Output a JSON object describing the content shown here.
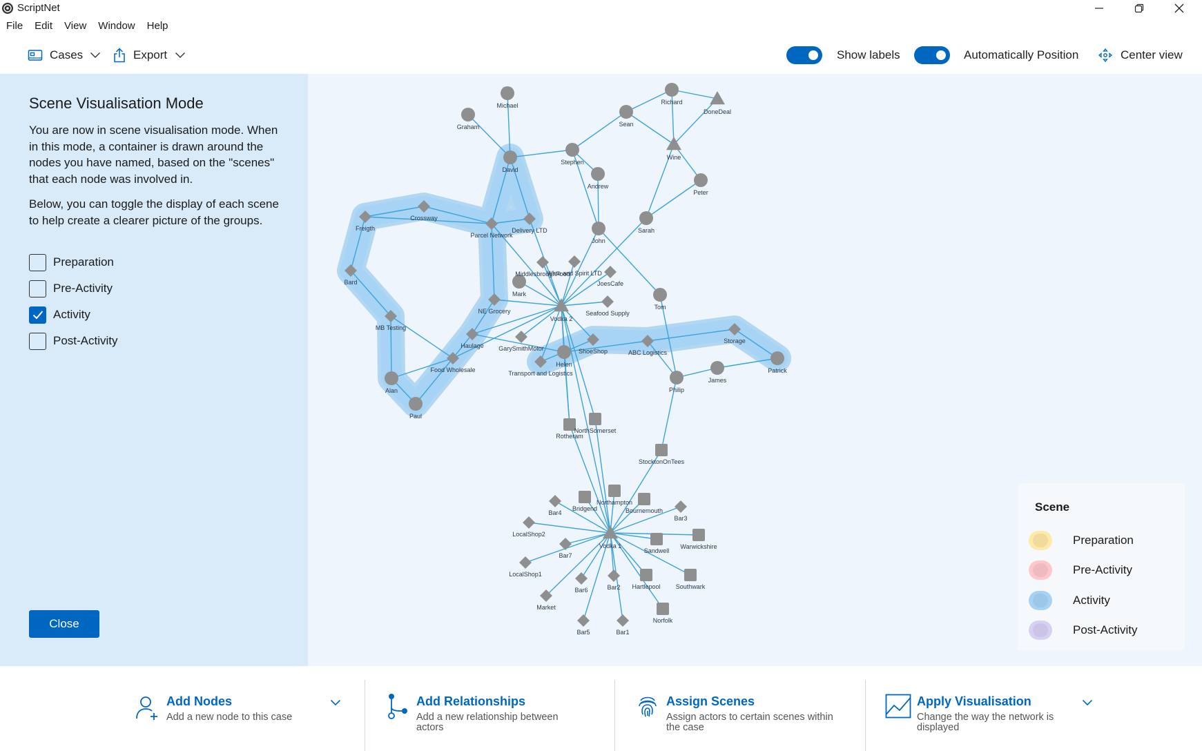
{
  "app": {
    "title": "ScriptNet"
  },
  "menu": [
    "File",
    "Edit",
    "View",
    "Window",
    "Help"
  ],
  "toolbar": {
    "cases_label": "Cases",
    "export_label": "Export",
    "show_labels": "Show labels",
    "show_labels_on": true,
    "auto_position": "Automatically Position",
    "auto_position_on": true,
    "center_view": "Center view"
  },
  "side_panel": {
    "title": "Scene Visualisation Mode",
    "para1": "You are now in scene visualisation mode. When in this mode, a container is drawn around the nodes you have named, based on the \"scenes\" that each node was involved in.",
    "para2": "Below, you can toggle the display of each scene to help create a clearer picture of the groups.",
    "scenes": [
      {
        "label": "Preparation",
        "checked": false
      },
      {
        "label": "Pre-Activity",
        "checked": false
      },
      {
        "label": "Activity",
        "checked": true
      },
      {
        "label": "Post-Activity",
        "checked": false
      }
    ],
    "close_label": "Close"
  },
  "legend": {
    "title": "Scene",
    "items": [
      {
        "label": "Preparation",
        "color": "#ffe9a6"
      },
      {
        "label": "Pre-Activity",
        "color": "#ffc7cc"
      },
      {
        "label": "Activity",
        "color": "#a6d3f5"
      },
      {
        "label": "Post-Activity",
        "color": "#d7d0f5"
      }
    ]
  },
  "graph": {
    "node_color": "#8f8f8f",
    "edge_color": "#3ea3d8",
    "hull_color": "#9dcdf0",
    "nodes": [
      {
        "id": "Michael",
        "label": "Michael",
        "shape": "circle"
      },
      {
        "id": "Graham",
        "label": "Graham",
        "shape": "circle"
      },
      {
        "id": "David",
        "label": "David",
        "shape": "circle"
      },
      {
        "id": "Stephen",
        "label": "Stephen",
        "shape": "circle"
      },
      {
        "id": "Andrew",
        "label": "Andrew",
        "shape": "circle"
      },
      {
        "id": "Sean",
        "label": "Sean",
        "shape": "circle"
      },
      {
        "id": "Richard",
        "label": "Richard",
        "shape": "circle"
      },
      {
        "id": "DoneDeal",
        "label": "DoneDeal",
        "shape": "triangle"
      },
      {
        "id": "Wine",
        "label": "Wine",
        "shape": "triangle"
      },
      {
        "id": "Peter",
        "label": "Peter",
        "shape": "circle"
      },
      {
        "id": "Sarah",
        "label": "Sarah",
        "shape": "circle"
      },
      {
        "id": "John",
        "label": "John",
        "shape": "circle"
      },
      {
        "id": "Tom",
        "label": "Tom",
        "shape": "circle"
      },
      {
        "id": "Mark",
        "label": "Mark",
        "shape": "circle"
      },
      {
        "id": "Helen",
        "label": "Helen",
        "shape": "circle"
      },
      {
        "id": "Philip",
        "label": "Philip",
        "shape": "circle"
      },
      {
        "id": "James",
        "label": "James",
        "shape": "circle"
      },
      {
        "id": "Patrick",
        "label": "Patrick",
        "shape": "circle"
      },
      {
        "id": "Alan",
        "label": "Alan",
        "shape": "circle"
      },
      {
        "id": "Paul",
        "label": "Paul",
        "shape": "circle"
      },
      {
        "id": "Freight",
        "label": "Freigth",
        "shape": "diamond"
      },
      {
        "id": "Crossway",
        "label": "Crossway",
        "shape": "diamond"
      },
      {
        "id": "ParcelNetwork",
        "label": "Parcel Network",
        "shape": "diamond"
      },
      {
        "id": "DeliveryLTD",
        "label": "Delivery LTD",
        "shape": "diamond"
      },
      {
        "id": "Bard",
        "label": "Bard",
        "shape": "diamond"
      },
      {
        "id": "MBTesting",
        "label": "MB Testing",
        "shape": "diamond"
      },
      {
        "id": "NEGrocery",
        "label": "NE Grocery",
        "shape": "diamond"
      },
      {
        "id": "Haulage",
        "label": "Haulage",
        "shape": "diamond"
      },
      {
        "id": "FoodWholesale",
        "label": "Food Wholesale",
        "shape": "diamond"
      },
      {
        "id": "Middlesbrough",
        "label": "MiddlesbroughFood",
        "shape": "diamond"
      },
      {
        "id": "WineSpirit",
        "label": "Wine and Spirit LTD",
        "shape": "diamond"
      },
      {
        "id": "JoesCafe",
        "label": "JoesCafe",
        "shape": "diamond"
      },
      {
        "id": "SeafoodSupply",
        "label": "Seafood Supply",
        "shape": "diamond"
      },
      {
        "id": "Vodka2",
        "label": "Vodka 2",
        "shape": "triangle"
      },
      {
        "id": "GarySmithMotor",
        "label": "GarySmithMotor",
        "shape": "diamond"
      },
      {
        "id": "ShoeShop",
        "label": "ShoeShop",
        "shape": "diamond"
      },
      {
        "id": "TransportLogistics",
        "label": "Transport and Logistics",
        "shape": "diamond"
      },
      {
        "id": "ABCLogistics",
        "label": "ABC Logistics",
        "shape": "diamond"
      },
      {
        "id": "Storage",
        "label": "Storage",
        "shape": "diamond"
      },
      {
        "id": "Rotheram",
        "label": "Rotheram",
        "shape": "square"
      },
      {
        "id": "NorthSomerset",
        "label": "NorthSomerset",
        "shape": "square"
      },
      {
        "id": "StocktonOnTees",
        "label": "StocktonOnTees",
        "shape": "square"
      },
      {
        "id": "Vodka1",
        "label": "Vodka 1",
        "shape": "triangle"
      },
      {
        "id": "Bar4",
        "label": "Bar4",
        "shape": "diamond"
      },
      {
        "id": "Bridgend",
        "label": "Bridgend",
        "shape": "square"
      },
      {
        "id": "Northampton",
        "label": "Northampton",
        "shape": "square"
      },
      {
        "id": "Bournemouth",
        "label": "Bournemouth",
        "shape": "square"
      },
      {
        "id": "Bar3",
        "label": "Bar3",
        "shape": "diamond"
      },
      {
        "id": "LocalShop2",
        "label": "LocalShop2",
        "shape": "diamond"
      },
      {
        "id": "Bar7",
        "label": "Bar7",
        "shape": "diamond"
      },
      {
        "id": "Sandwell",
        "label": "Sandwell",
        "shape": "square"
      },
      {
        "id": "Warwickshire",
        "label": "Warwickshire",
        "shape": "square"
      },
      {
        "id": "LocalShop1",
        "label": "LocalShop1",
        "shape": "diamond"
      },
      {
        "id": "Bar6",
        "label": "Bar6",
        "shape": "diamond"
      },
      {
        "id": "Bar2",
        "label": "Bar2",
        "shape": "diamond"
      },
      {
        "id": "Hartlepool",
        "label": "Hartlepool",
        "shape": "square"
      },
      {
        "id": "Southwark",
        "label": "Southwark",
        "shape": "square"
      },
      {
        "id": "Market",
        "label": "Market",
        "shape": "diamond"
      },
      {
        "id": "Norfolk",
        "label": "Norfolk",
        "shape": "square"
      },
      {
        "id": "Bar5",
        "label": "Bar5",
        "shape": "diamond"
      },
      {
        "id": "Bar1",
        "label": "Bar1",
        "shape": "diamond"
      }
    ],
    "edges": [
      [
        "Michael",
        "David"
      ],
      [
        "Graham",
        "David"
      ],
      [
        "David",
        "Stephen"
      ],
      [
        "David",
        "ParcelNetwork"
      ],
      [
        "David",
        "DeliveryLTD"
      ],
      [
        "Stephen",
        "Sean"
      ],
      [
        "Stephen",
        "Andrew"
      ],
      [
        "Stephen",
        "John"
      ],
      [
        "Sean",
        "Richard"
      ],
      [
        "Sean",
        "Wine"
      ],
      [
        "Richard",
        "DoneDeal"
      ],
      [
        "Richard",
        "Wine"
      ],
      [
        "DoneDeal",
        "Wine"
      ],
      [
        "Wine",
        "Peter"
      ],
      [
        "Wine",
        "Sarah"
      ],
      [
        "Peter",
        "Sarah"
      ],
      [
        "Andrew",
        "John"
      ],
      [
        "Sarah",
        "Vodka2"
      ],
      [
        "John",
        "Vodka2"
      ],
      [
        "John",
        "Tom"
      ],
      [
        "Freight",
        "Crossway"
      ],
      [
        "Freight",
        "ParcelNetwork"
      ],
      [
        "Crossway",
        "ParcelNetwork"
      ],
      [
        "ParcelNetwork",
        "DeliveryLTD"
      ],
      [
        "ParcelNetwork",
        "NEGrocery"
      ],
      [
        "ParcelNetwork",
        "Vodka2"
      ],
      [
        "DeliveryLTD",
        "Vodka2"
      ],
      [
        "Freight",
        "Bard"
      ],
      [
        "Bard",
        "MBTesting"
      ],
      [
        "MBTesting",
        "FoodWholesale"
      ],
      [
        "MBTesting",
        "Alan"
      ],
      [
        "FoodWholesale",
        "Alan"
      ],
      [
        "FoodWholesale",
        "Paul"
      ],
      [
        "Alan",
        "Paul"
      ],
      [
        "Haulage",
        "FoodWholesale"
      ],
      [
        "NEGrocery",
        "Haulage"
      ],
      [
        "Haulage",
        "Vodka2"
      ],
      [
        "Haulage",
        "Helen"
      ],
      [
        "FoodWholesale",
        "Vodka2"
      ],
      [
        "Middlesbrough",
        "Vodka2"
      ],
      [
        "WineSpirit",
        "Vodka2"
      ],
      [
        "JoesCafe",
        "Vodka2"
      ],
      [
        "SeafoodSupply",
        "Vodka2"
      ],
      [
        "Mark",
        "Vodka2"
      ],
      [
        "NEGrocery",
        "Vodka2"
      ],
      [
        "GarySmithMotor",
        "Vodka2"
      ],
      [
        "ShoeShop",
        "Vodka2"
      ],
      [
        "TransportLogistics",
        "Vodka2"
      ],
      [
        "Helen",
        "Vodka2"
      ],
      [
        "Helen",
        "ShoeShop"
      ],
      [
        "Helen",
        "TransportLogistics"
      ],
      [
        "Helen",
        "ABCLogistics"
      ],
      [
        "ABCLogistics",
        "Storage"
      ],
      [
        "Storage",
        "Patrick"
      ],
      [
        "ABCLogistics",
        "Philip"
      ],
      [
        "Philip",
        "James"
      ],
      [
        "James",
        "Patrick"
      ],
      [
        "Tom",
        "Philip"
      ],
      [
        "Philip",
        "StocktonOnTees"
      ],
      [
        "Vodka2",
        "Rotheram"
      ],
      [
        "Vodka2",
        "NorthSomerset"
      ],
      [
        "Vodka2",
        "Vodka1"
      ],
      [
        "Helen",
        "Rotheram"
      ],
      [
        "StocktonOnTees",
        "Vodka1"
      ],
      [
        "NorthSomerset",
        "Vodka1"
      ],
      [
        "Rotheram",
        "Vodka1"
      ],
      [
        "Vodka1",
        "Bar4"
      ],
      [
        "Vodka1",
        "Bridgend"
      ],
      [
        "Vodka1",
        "Northampton"
      ],
      [
        "Vodka1",
        "Bournemouth"
      ],
      [
        "Vodka1",
        "Bar3"
      ],
      [
        "Vodka1",
        "LocalShop2"
      ],
      [
        "Vodka1",
        "Bar7"
      ],
      [
        "Vodka1",
        "Sandwell"
      ],
      [
        "Vodka1",
        "Warwickshire"
      ],
      [
        "Vodka1",
        "LocalShop1"
      ],
      [
        "Vodka1",
        "Bar6"
      ],
      [
        "Vodka1",
        "Bar2"
      ],
      [
        "Vodka1",
        "Hartlepool"
      ],
      [
        "Vodka1",
        "Southwark"
      ],
      [
        "Vodka1",
        "Market"
      ],
      [
        "Vodka1",
        "Norfolk"
      ],
      [
        "Vodka1",
        "Bar5"
      ],
      [
        "Vodka1",
        "Bar1"
      ]
    ],
    "scene_groups": [
      {
        "scene": "Activity",
        "members": [
          "David",
          "ParcelNetwork",
          "DeliveryLTD",
          "Crossway",
          "Freight",
          "Bard",
          "MBTesting",
          "FoodWholesale",
          "Alan",
          "Paul",
          "Haulage",
          "NEGrocery"
        ]
      },
      {
        "scene": "Activity",
        "members": [
          "TransportLogistics",
          "Helen",
          "ShoeShop",
          "ABCLogistics",
          "Storage",
          "Patrick"
        ]
      }
    ]
  },
  "bottom": {
    "add_nodes": {
      "title": "Add Nodes",
      "desc": "Add a new node to this case"
    },
    "add_relationships": {
      "title": "Add Relationships",
      "desc": "Add a new relationship between actors"
    },
    "assign_scenes": {
      "title": "Assign Scenes",
      "desc": "Assign actors to certain scenes within the case"
    },
    "apply_visualisation": {
      "title": "Apply Visualisation",
      "desc": "Change the way the network is displayed"
    }
  }
}
